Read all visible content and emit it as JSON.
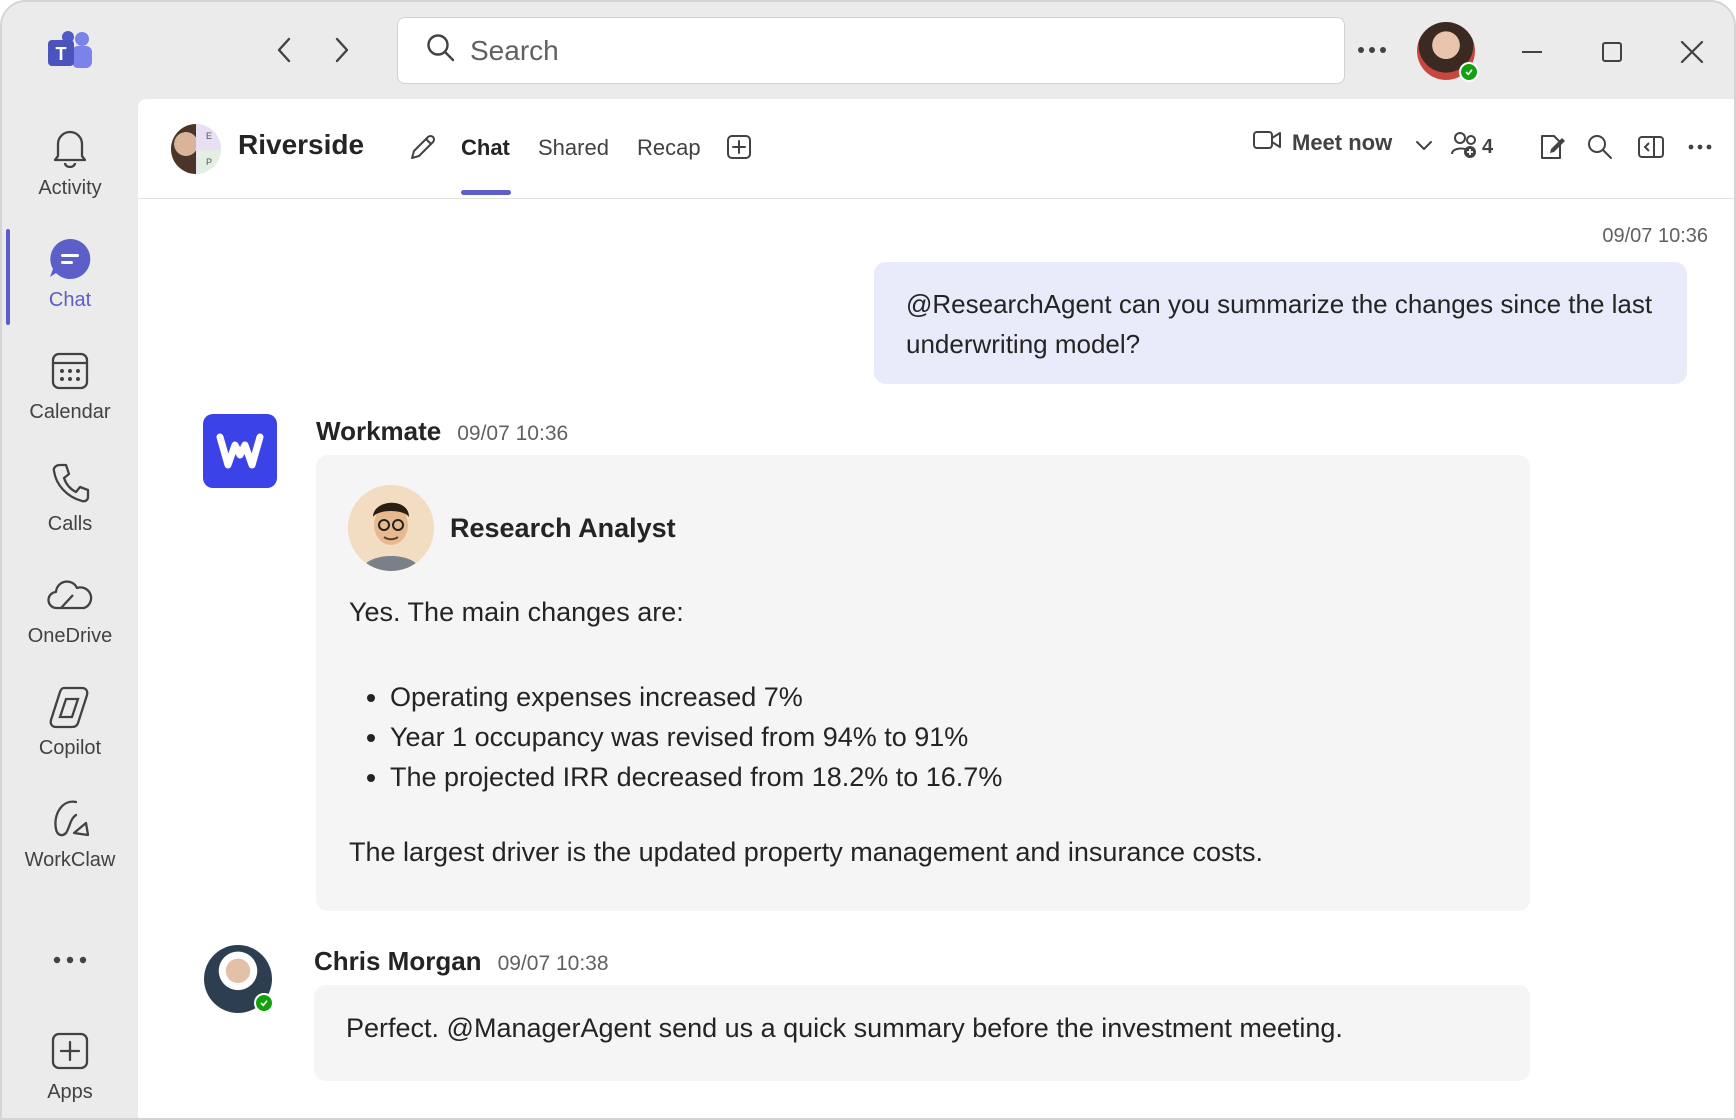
{
  "titlebar": {
    "search_placeholder": "Search"
  },
  "rail": {
    "items": [
      {
        "label": "Activity",
        "icon": "bell-icon"
      },
      {
        "label": "Chat",
        "icon": "chat-icon",
        "active": true
      },
      {
        "label": "Calendar",
        "icon": "calendar-icon"
      },
      {
        "label": "Calls",
        "icon": "phone-icon"
      },
      {
        "label": "OneDrive",
        "icon": "cloud-icon"
      },
      {
        "label": "Copilot",
        "icon": "copilot-icon"
      },
      {
        "label": "WorkClaw",
        "icon": "workclaw-icon"
      },
      {
        "label": "Apps",
        "icon": "add-app-icon"
      }
    ]
  },
  "header": {
    "chat_title": "Riverside",
    "group_initials": [
      "E",
      "P"
    ],
    "tabs": [
      "Chat",
      "Shared",
      "Recap"
    ],
    "active_tab": "Chat",
    "meet_label": "Meet now",
    "participant_count": "4"
  },
  "messages": {
    "mine": {
      "time": "09/07 10:36",
      "text": "@ResearchAgent can you summarize the changes since the last underwriting model?"
    },
    "workmate": {
      "sender": "Workmate",
      "time": "09/07 10:36",
      "card": {
        "title": "Research Analyst",
        "intro": "Yes. The main changes are:",
        "bullets": [
          "Operating expenses increased 7%",
          "Year 1 occupancy was revised from 94% to 91%",
          "The projected IRR decreased from 18.2% to 16.7%"
        ],
        "outro": "The largest driver is the updated property management and insurance costs."
      }
    },
    "chris": {
      "sender": "Chris Morgan",
      "time": "09/07 10:38",
      "text": "Perfect. @ManagerAgent send us a quick summary before the investment meeting."
    }
  },
  "colors": {
    "accent": "#5b5fc7",
    "my_bubble": "#e8ebfa",
    "card_bg": "#f5f5f5",
    "bot_brand": "#3b43e8",
    "presence": "#13a10e"
  }
}
